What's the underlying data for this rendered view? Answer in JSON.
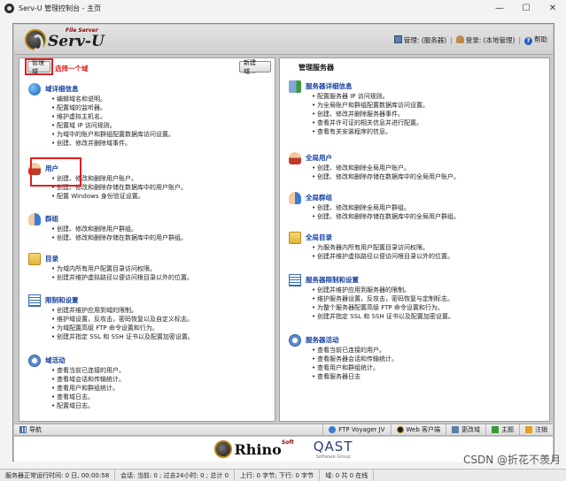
{
  "window": {
    "title": "Serv-U 管理控制台 - 主页",
    "controls": {
      "minimize": "—",
      "maximize": "☐",
      "close": "✕"
    }
  },
  "header": {
    "logo_text": "Serv-U",
    "logo_sub": "File Server",
    "links": {
      "manage": "管理: (服务器)",
      "login": "登录: (本地管理)",
      "help": "帮助"
    }
  },
  "left_panel": {
    "manage_domain_button": "管理域",
    "select_domain_hint": "选择一个域",
    "new_domain_button": "新建域...",
    "sections": [
      {
        "icon": "globe-icon",
        "title": "域详细信息",
        "items": [
          "编辑域名和说明。",
          "配置域的监听器。",
          "维护虚拟主机名。",
          "配置域 IP 访问规则。",
          "为域中的账户和群组配置数据库访问设置。",
          "创建、修改并删除域事件。"
        ]
      },
      {
        "icon": "user-icon",
        "title": "用户",
        "items": [
          "创建、修改和删除用户账户。",
          "创建、修改和删除存储在数据库中的用户账户。",
          "配置 Windows 身份验证设置。"
        ]
      },
      {
        "icon": "group-icon",
        "title": "群组",
        "items": [
          "创建、修改和删除用户群组。",
          "创建、修改和删除存储在数据库中的用户群组。"
        ]
      },
      {
        "icon": "folder-icon",
        "title": "目录",
        "items": [
          "为域内所有用户配置目录访问权限。",
          "创建并维护虚拟路径以便访问根目录以外的位置。"
        ]
      },
      {
        "icon": "list-icon",
        "title": "限制和设置",
        "items": [
          "创建并维护应用到域的限制。",
          "维护域设置，反攻击，密码恢复以及自定义标志。",
          "为域配置高级 FTP 命令设置和行为。",
          "创建并指定 SSL 和 SSH 证书以及配置加密设置。"
        ]
      },
      {
        "icon": "activity-icon",
        "title": "域活动",
        "items": [
          "查看当前已连接的用户。",
          "查看域会话和传输统计。",
          "查看用户和群组统计。",
          "查看域日志。",
          "配置域日志。"
        ]
      }
    ]
  },
  "right_panel": {
    "title": "管理服务器",
    "sections": [
      {
        "icon": "servers-icon",
        "title": "服务器详细信息",
        "items": [
          "配置服务器 IP 访问规则。",
          "为全局账户和群组配置数据库访问设置。",
          "创建、修改并删除服务器事件。",
          "查看并许可证的相关信息并进行配置。",
          "查看有关安装程序的信息。"
        ]
      },
      {
        "icon": "user-icon",
        "title": "全局用户",
        "items": [
          "创建、修改和删除全局用户账户。",
          "创建、修改和删除存储在数据库中的全局用户账户。"
        ]
      },
      {
        "icon": "group-icon",
        "title": "全局群组",
        "items": [
          "创建、修改和删除全局用户群组。",
          "创建、修改和删除存储在数据库中的全局用户群组。"
        ]
      },
      {
        "icon": "folder-icon",
        "title": "全局目录",
        "items": [
          "为服务器内所有用户配置目录访问权限。",
          "创建并维护虚拟路径以便访问根目录以外的位置。"
        ]
      },
      {
        "icon": "list-icon",
        "title": "服务器限制和设置",
        "items": [
          "创建并维护应用到服务器的限制。",
          "维护服务器设置，反攻击，密码恢复与定制标志。",
          "为整个服务器配置高级 FTP 命令设置和行为。",
          "创建并指定 SSL 和 SSH 证书以及配置加密设置。"
        ]
      },
      {
        "icon": "activity-icon",
        "title": "服务器活动",
        "items": [
          "查看当前已连接的用户。",
          "查看服务器会话和传输统计。",
          "查看用户和群组统计。",
          "查看服务器日志"
        ]
      }
    ]
  },
  "toolbar": {
    "nav": "导航",
    "ftp_voyager": "FTP Voyager JV",
    "web_client": "Web 客户端",
    "change_domain": "更改域",
    "theme": "主题",
    "logout": "注销"
  },
  "footer": {
    "rhino": "Rhino",
    "rhino_sup": "Soft",
    "qast": "QAST",
    "qast_sub": "Software Group"
  },
  "statusbar": {
    "uptime": "服务器正常运行时间: 0 日, 00:00:58",
    "sessions": "会话: 当前: 0 ; 过去24小时: 0 ; 总计 0",
    "up": "上行: 0 字节; 下行: 0 字节",
    "domains": "域: 0 共 0 在线"
  },
  "watermark": "CSDN @折花不羡月"
}
